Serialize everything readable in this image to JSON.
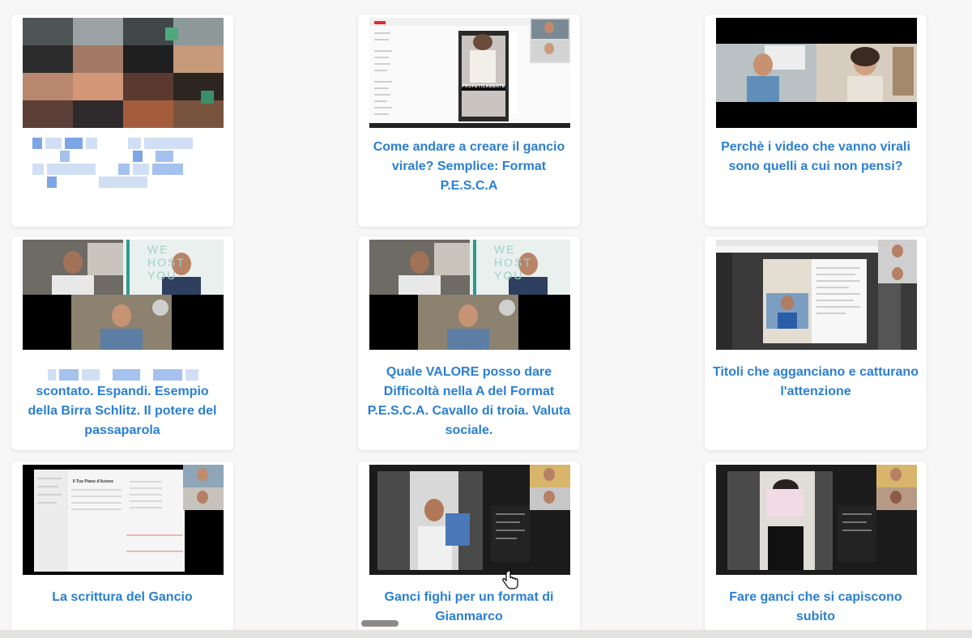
{
  "cards": [
    {
      "title": "",
      "thumbnail": "blurred-video-thumbnail"
    },
    {
      "title": "Come andare a creare il gancio virale? Semplice: Format P.E.S.C.A",
      "thumbnail": "screen-share-video-thumbnail",
      "overlay_text": "PROFETICAMENTE"
    },
    {
      "title": "Perchè i video che vanno virali sono quelli a cui non pensi?",
      "thumbnail": "two-person-call-thumbnail"
    },
    {
      "title": "scontato. Espandi. Esempio della Birra Schlitz. Il potere del passaparola",
      "thumbnail": "three-person-call-thumbnail",
      "overlay_text": "WE HOST YOU"
    },
    {
      "title": "Quale VALORE posso dare Difficoltà nella A del Format P.E.S.C.A. Cavallo di troia. Valuta sociale.",
      "thumbnail": "three-person-call-thumbnail",
      "overlay_text": "WE HOST YOU"
    },
    {
      "title": "Titoli che agganciano e catturano l'attenzione",
      "thumbnail": "screen-share-video-thumbnail"
    },
    {
      "title": "La scrittura del Gancio",
      "thumbnail": "document-share-thumbnail",
      "overlay_text": "Il Tuo Piano d'Azione"
    },
    {
      "title": "Ganci fighi per un format di Gianmarco",
      "thumbnail": "video-with-chat-thumbnail"
    },
    {
      "title": "Fare ganci che si capiscono subito",
      "thumbnail": "video-with-chat-thumbnail"
    }
  ],
  "colors": {
    "title": "#2a7fd4",
    "card_bg": "#ffffff",
    "page_bg": "#f7f7f8"
  }
}
